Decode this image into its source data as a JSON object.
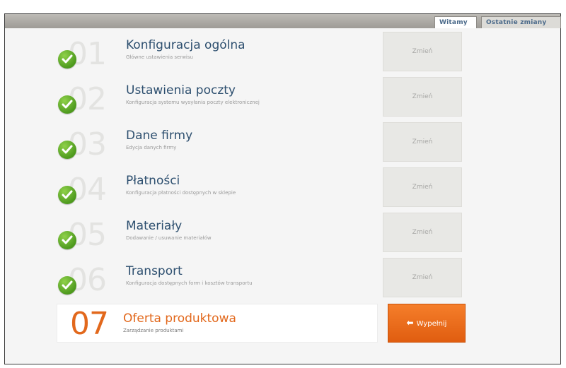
{
  "tabs": [
    {
      "label": "Witamy"
    },
    {
      "label": "Ostatnie zmiany"
    }
  ],
  "steps": [
    {
      "num": "01",
      "title": "Konfiguracja ogólna",
      "desc": "Główne ustawienia serwisu",
      "button": "Zmień"
    },
    {
      "num": "02",
      "title": "Ustawienia poczty",
      "desc": "Konfiguracja systemu wysyłania poczty elektronicznej",
      "button": "Zmień"
    },
    {
      "num": "03",
      "title": "Dane firmy",
      "desc": "Edycja danych firmy",
      "button": "Zmień"
    },
    {
      "num": "04",
      "title": "Płatności",
      "desc": "Konfiguracja płatności dostępnych w sklepie",
      "button": "Zmień"
    },
    {
      "num": "05",
      "title": "Materiały",
      "desc": "Dodawanie / usuwanie materiałów",
      "button": "Zmień"
    },
    {
      "num": "06",
      "title": "Transport",
      "desc": "Konfiguracja dostępnych form i kosztów transportu",
      "button": "Zmień"
    }
  ],
  "active_step": {
    "num": "07",
    "title": "Oferta produktowa",
    "desc": "Zarządzanie produktami",
    "button": "Wypełnij"
  },
  "icons": {
    "completed": "check-icon",
    "fill_arrow": "arrow-left-icon"
  },
  "colors": {
    "title_blue": "#2d4f6f",
    "accent_orange": "#e2681c",
    "check_green": "#5aa825"
  }
}
